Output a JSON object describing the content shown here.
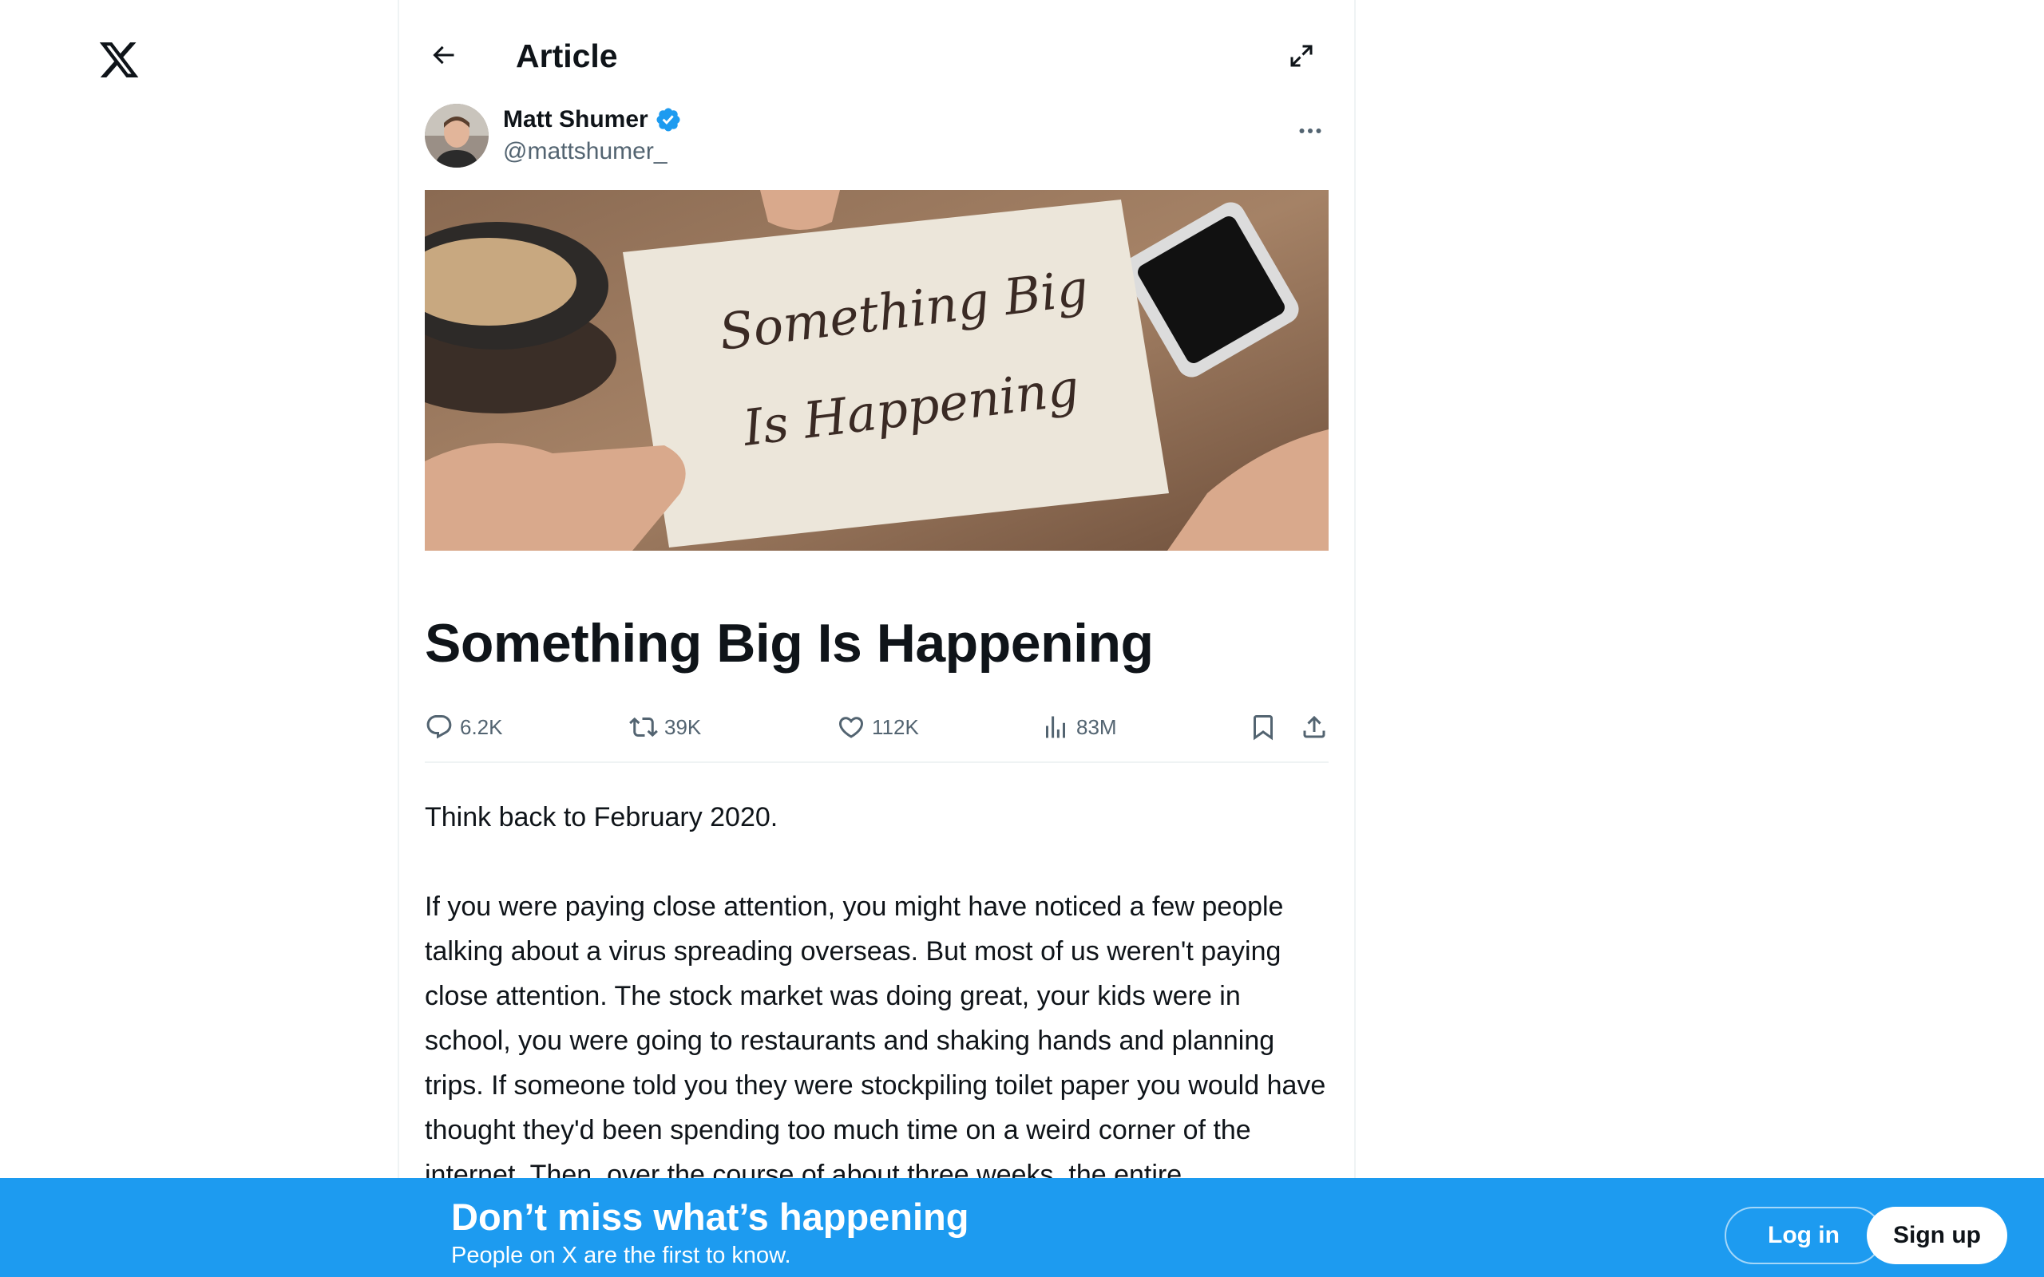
{
  "header": {
    "title": "Article"
  },
  "author": {
    "name": "Matt Shumer",
    "handle": "@mattshumer_"
  },
  "hero": {
    "card_line_1": "Something Big",
    "card_line_2": "Is Happening"
  },
  "article": {
    "title": "Something Big Is Happening",
    "paragraphs": [
      "Think back to February 2020.",
      "If you were paying close attention, you might have noticed a few people talking about a virus spreading overseas. But most of us weren't paying close attention. The stock market was doing great, your kids were in school, you were going to restaurants and shaking hands and planning trips. If someone told you they were stockpiling toilet paper you would have thought they'd been spending too much time on a weird corner of the internet. Then, over the course of about three weeks, the entire"
    ]
  },
  "stats": {
    "replies": "6.2K",
    "retweets": "39K",
    "likes": "112K",
    "views": "83M"
  },
  "banner": {
    "title": "Don’t miss what’s happening",
    "subtitle": "People on X are the first to know.",
    "login_label": "Log in",
    "signup_label": "Sign up"
  },
  "colors": {
    "accent": "#1d9bf0",
    "verified": "#1d9bf0",
    "text": "#0f1419",
    "secondary": "#536471"
  },
  "icons": [
    "x-logo-icon",
    "back-arrow-icon",
    "expand-icon",
    "verified-badge-icon",
    "more-icon",
    "reply-icon",
    "retweet-icon",
    "like-icon",
    "views-icon",
    "bookmark-icon",
    "share-icon"
  ]
}
